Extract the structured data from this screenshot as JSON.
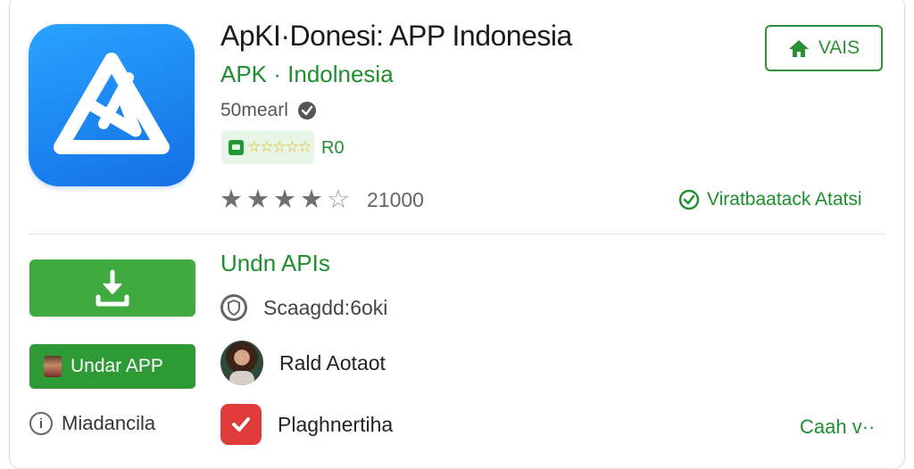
{
  "app": {
    "title": "ApKI·Donesi: APP Indonesia",
    "subtitle": "APK · Indolnesia",
    "meta_text": "50mearl",
    "rating_badge_value": "R0",
    "rating_badge_stars": "☆☆☆☆☆",
    "star_rating": 4,
    "ratings_count": "21000",
    "verified_text": "Viratbaatack Atatsi"
  },
  "header_button": {
    "label": "VAIS"
  },
  "actions": {
    "open_label": "Undar APP"
  },
  "info": {
    "left_label": "Miadancila",
    "icon_char": "i"
  },
  "details": {
    "section_title": "Undn APIs",
    "rows": [
      {
        "label": "Scaagdd:6oki"
      },
      {
        "label": "Rald Aotaot"
      },
      {
        "label": "Plaghnertiha"
      }
    ]
  },
  "more": {
    "label": "Caah v··"
  },
  "colors": {
    "brand_green": "#1e8e2e",
    "button_green": "#3faa3f",
    "icon_blue": "#1c86f2",
    "check_red": "#e03a3a",
    "star_gold": "#e8b400"
  }
}
